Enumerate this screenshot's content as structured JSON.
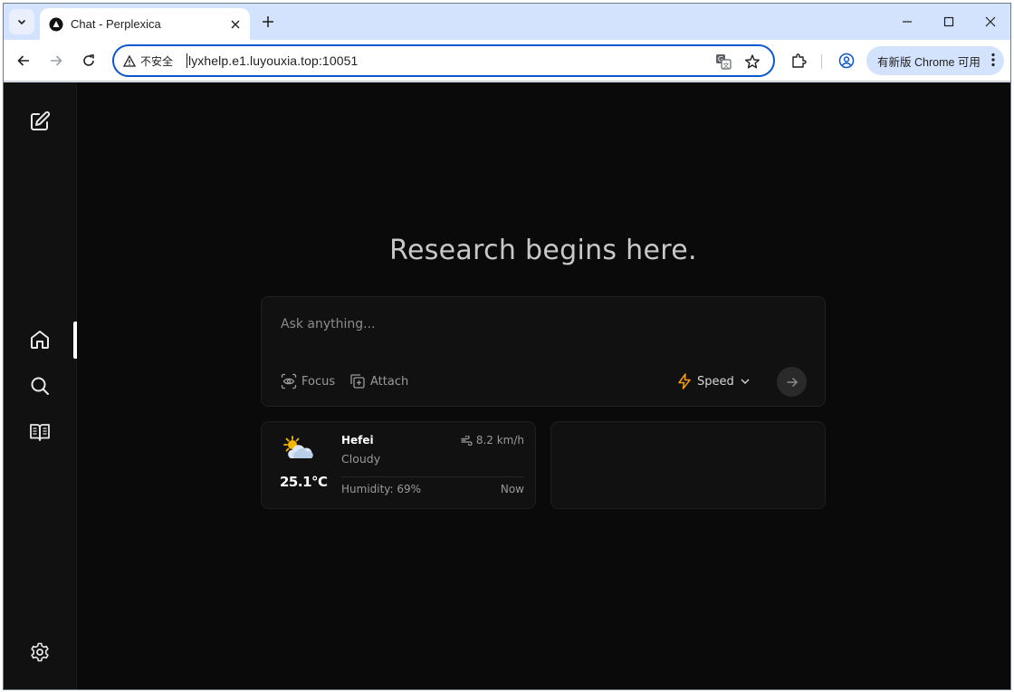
{
  "browser": {
    "tab": {
      "title": "Chat - Perplexica",
      "favicon": "perplexica-logo-icon"
    },
    "toolbar": {
      "security_label": "不安全",
      "url": "lyxhelp.e1.luyouxia.top:10051",
      "update_label": "有新版 Chrome 可用"
    },
    "colors": {
      "tabstrip": "#d3e3fd",
      "omnibox_border": "#0b57d0"
    }
  },
  "app": {
    "name": "Perplexica",
    "sidebar": {
      "items": [
        {
          "name": "new-chat",
          "icon": "edit-icon"
        },
        {
          "name": "home",
          "icon": "home-icon",
          "active": true
        },
        {
          "name": "discover",
          "icon": "search-icon"
        },
        {
          "name": "library",
          "icon": "book-open-icon"
        },
        {
          "name": "settings",
          "icon": "gear-icon"
        }
      ]
    },
    "headline": "Research begins here.",
    "search": {
      "placeholder": "Ask anything...",
      "focus_label": "Focus",
      "attach_label": "Attach",
      "mode_label": "Speed"
    },
    "weather": {
      "city": "Hefei",
      "condition": "Cloudy",
      "temperature": "25.1°C",
      "wind": "8.2 km/h",
      "humidity": "Humidity: 69%",
      "time": "Now",
      "icon": "partly-cloudy-icon"
    },
    "colors": {
      "background": "#0a0a0a",
      "sidebar": "#111111",
      "accent_speed": "#f59e0b"
    }
  }
}
